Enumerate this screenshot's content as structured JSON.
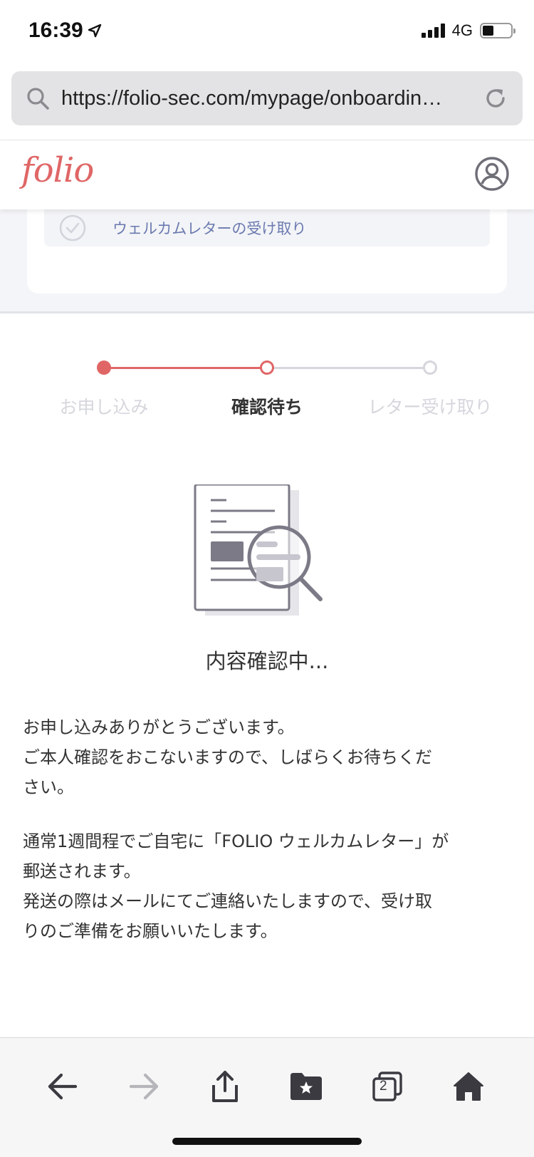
{
  "status_bar": {
    "time": "16:39",
    "network": "4G"
  },
  "browser": {
    "url": "https://folio-sec.com/mypage/onboardin…",
    "tab_count": "2"
  },
  "site": {
    "logo": "folio"
  },
  "card": {
    "item_label": "ウェルカムレターの受け取り"
  },
  "stepper": {
    "steps": [
      {
        "label": "お申し込み",
        "state": "done"
      },
      {
        "label": "確認待ち",
        "state": "current"
      },
      {
        "label": "レター受け取り",
        "state": "pending"
      }
    ],
    "colors": {
      "active": "#e06666",
      "inactive": "#d6d7dd"
    }
  },
  "main": {
    "status": "内容確認中...",
    "message1": [
      "お申し込みありがとうございます。",
      "ご本人確認をおこないますので、しばらくお待ちくだ",
      "さい。"
    ],
    "message2": [
      "通常1週間程でご自宅に「FOLIO ウェルカムレター」が",
      "郵送されます。",
      "発送の際はメールにてご連絡いたしますので、受け取",
      "りのご準備をお願いいたします。"
    ]
  },
  "colors": {
    "brand": "#e06666",
    "link": "#6b7ab0",
    "icon_grey": "#7b7a86"
  }
}
